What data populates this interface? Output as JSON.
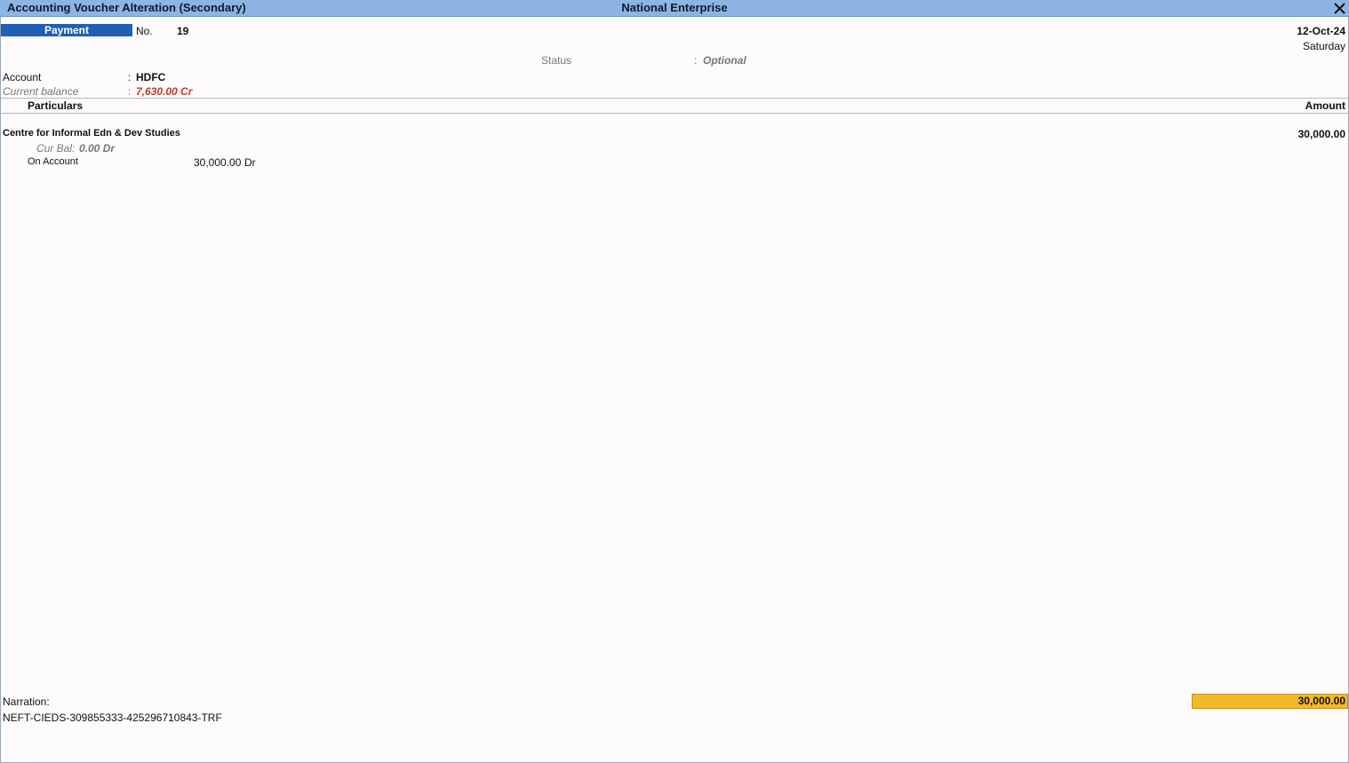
{
  "window": {
    "title": "Accounting Voucher Alteration (Secondary)",
    "company": "National Enterprise",
    "close_glyph": "✕"
  },
  "voucher": {
    "type": "Payment",
    "no_label": "No.",
    "no_value": "19",
    "date": "12-Oct-24",
    "day": "Saturday",
    "status_label": "Status",
    "status_sep": ":",
    "status_value": "Optional"
  },
  "account": {
    "label": "Account",
    "sep": ":",
    "value": "HDFC",
    "balance_label": "Current balance",
    "balance_sep": ":",
    "balance_value": "7,630.00 Cr"
  },
  "table": {
    "col_particulars": "Particulars",
    "col_amount": "Amount",
    "rows": [
      {
        "ledger": "Centre for Informal Edn & Dev Studies",
        "amount": "30,000.00",
        "cur_bal_label": "Cur Bal:",
        "cur_bal_value": "0.00 Dr",
        "bill_type": "On Account",
        "bill_amount": "30,000.00",
        "bill_drcr": "Dr"
      }
    ]
  },
  "footer": {
    "narration_label": "Narration:",
    "narration_text": "NEFT-CIEDS-309855333-425296710843-TRF",
    "total": "30,000.00"
  },
  "colors": {
    "titlebar": "#8db4e2",
    "voucher_type_bg": "#1f5fb5",
    "balance_red": "#c0392b",
    "total_bg": "#f2b92a"
  }
}
